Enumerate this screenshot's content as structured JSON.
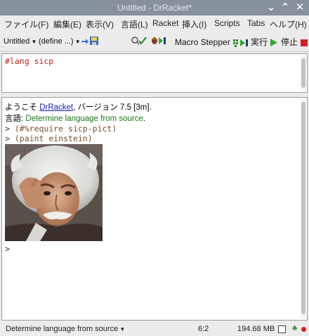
{
  "window": {
    "title": "Untitled - DrRacket*"
  },
  "menu": {
    "items": [
      "ファイル(F)",
      "編集(E)",
      "表示(V)",
      "言語(L)",
      "Racket",
      "挿入(I)",
      "Scripts",
      "Tabs",
      "ヘルプ(H)"
    ]
  },
  "toolbar": {
    "file_name": "Untitled",
    "define_menu": "(define ...)",
    "macro_stepper": "Macro Stepper",
    "run": "実行",
    "stop": "停止"
  },
  "editor": {
    "code": "#lang sicp"
  },
  "repl": {
    "welcome_prefix": "ようこそ ",
    "welcome_link": "DrRacket",
    "welcome_suffix": ", バージョン 7.5 [3m].",
    "language_label": "言語: ",
    "language_value": "Determine language from source",
    "language_end": ".",
    "prompt": ">",
    "input_1": "(#%require sicp-pict)",
    "input_2": "(paint einstein)",
    "empty_prompt": ">"
  },
  "status": {
    "language": "Determine language from source",
    "position": "6:2",
    "memory": "194.68 MB"
  },
  "icons": {
    "minimize": "chevron-down-icon",
    "maximize": "chevron-up-icon",
    "close": "close-icon",
    "save": "save-icon",
    "check_syntax": "check-syntax-icon",
    "debug": "debug-icon",
    "run": "run-icon",
    "stop": "stop-icon"
  },
  "colors": {
    "title_bar": "#87919c",
    "code_red": "#c81e1e",
    "link_blue": "#1a1ab3",
    "language_green": "#1a7a1a",
    "run_green": "#2fa82f",
    "stop_red": "#d42020"
  }
}
